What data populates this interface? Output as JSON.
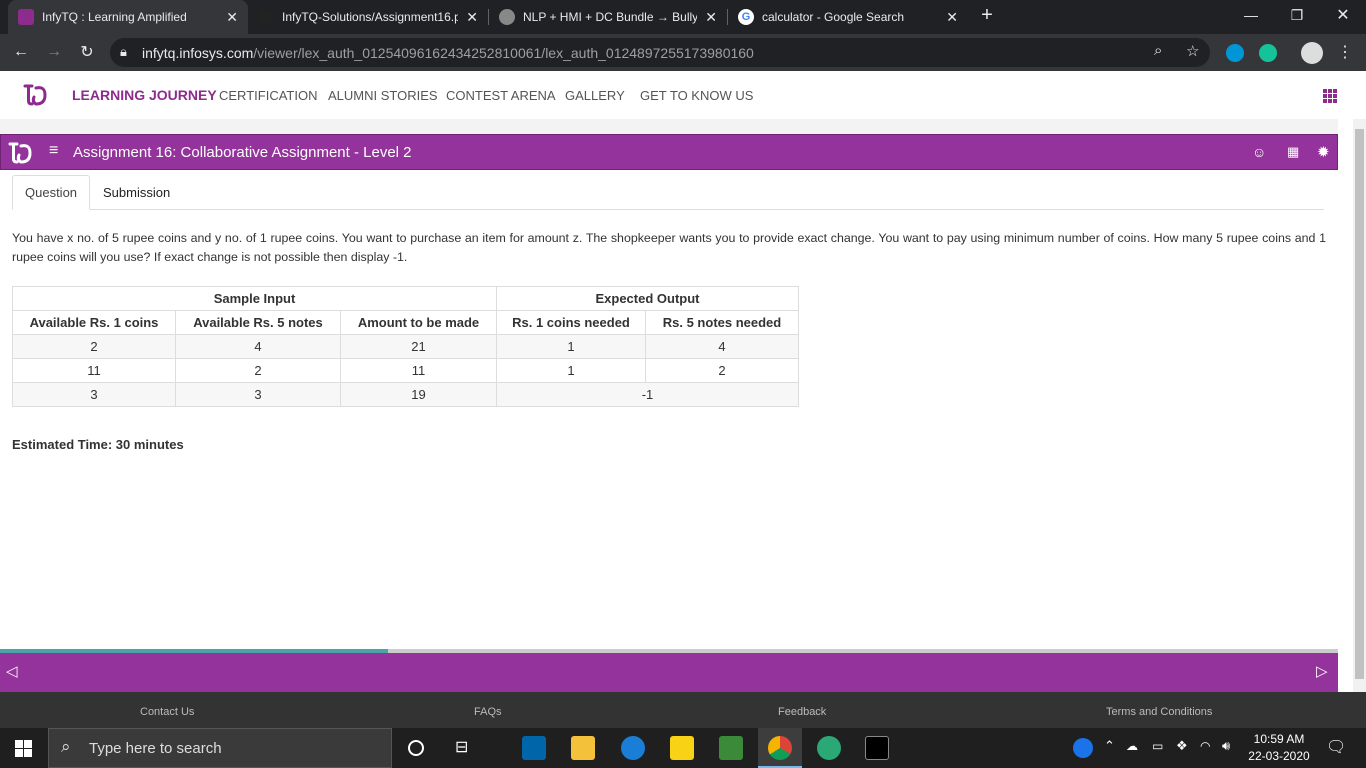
{
  "browser": {
    "tabs": [
      {
        "title": "InfyTQ : Learning Amplified",
        "active": true
      },
      {
        "title": "InfyTQ-Solutions/Assignment16.p",
        "active": false
      },
      {
        "title": "NLP + HMI + DC Bundle → Bully",
        "active": false
      },
      {
        "title": "calculator - Google Search",
        "active": false
      }
    ],
    "new_tab": "+",
    "url_host": "infytq.infosys.com",
    "url_path": "/viewer/lex_auth_01254096162434252810061/lex_auth_0124897255173980160"
  },
  "site_nav": {
    "items": [
      "LEARNING JOURNEY",
      "CERTIFICATION",
      "ALUMNI STORIES",
      "CONTEST ARENA",
      "GALLERY",
      "GET TO KNOW US"
    ]
  },
  "assignment": {
    "title": "Assignment 16: Collaborative Assignment - Level 2",
    "tabs": [
      "Question",
      "Submission"
    ],
    "question": "You have x no. of 5 rupee coins and y no. of 1 rupee coins. You want to purchase an item for amount z. The shopkeeper wants you to provide exact change. You want to pay using minimum number of coins. How many 5 rupee coins and 1 rupee coins will you use? If exact change is not possible then display -1.",
    "table": {
      "group_headers": [
        "Sample Input",
        "Expected Output"
      ],
      "headers": [
        "Available Rs. 1 coins",
        "Available Rs. 5 notes",
        "Amount to be made",
        "Rs. 1 coins needed",
        "Rs. 5 notes needed"
      ],
      "rows": [
        [
          "2",
          "4",
          "21",
          "1",
          "4"
        ],
        [
          "11",
          "2",
          "11",
          "1",
          "2"
        ],
        [
          "3",
          "3",
          "19",
          "-1"
        ]
      ]
    },
    "estimated_time": "Estimated Time: 30 minutes",
    "progress": 0.29
  },
  "footer": {
    "links": [
      "Contact Us",
      "FAQs",
      "Feedback",
      "Terms and Conditions"
    ]
  },
  "taskbar": {
    "search_placeholder": "Type here to search",
    "time": "10:59 AM",
    "date": "22-03-2020"
  },
  "colors": {
    "brand_purple": "#93339b",
    "progress_teal": "#4aa3a8"
  }
}
